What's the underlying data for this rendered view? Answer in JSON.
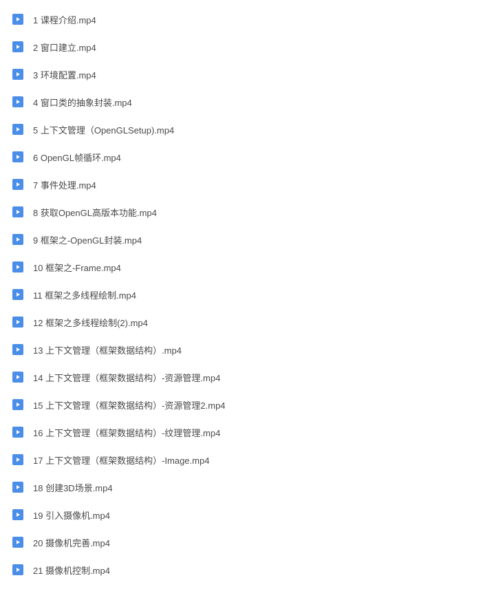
{
  "files": [
    {
      "name": "1 课程介绍.mp4"
    },
    {
      "name": "2 窗口建立.mp4"
    },
    {
      "name": "3 环境配置.mp4"
    },
    {
      "name": "4 窗口类的抽象封装.mp4"
    },
    {
      "name": "5 上下文管理（OpenGLSetup).mp4"
    },
    {
      "name": "6 OpenGL帧循环.mp4"
    },
    {
      "name": "7 事件处理.mp4"
    },
    {
      "name": "8 获取OpenGL高版本功能.mp4"
    },
    {
      "name": "9 框架之-OpenGL封装.mp4"
    },
    {
      "name": "10 框架之-Frame.mp4"
    },
    {
      "name": "11 框架之多线程绘制.mp4"
    },
    {
      "name": "12 框架之多线程绘制(2).mp4"
    },
    {
      "name": "13 上下文管理（框架数据结构）.mp4"
    },
    {
      "name": "14 上下文管理（框架数据结构）-资源管理.mp4"
    },
    {
      "name": "15 上下文管理（框架数据结构）-资源管理2.mp4"
    },
    {
      "name": "16 上下文管理（框架数据结构）-纹理管理.mp4"
    },
    {
      "name": "17 上下文管理（框架数据结构）-Image.mp4"
    },
    {
      "name": "18 创建3D场景.mp4"
    },
    {
      "name": "19 引入摄像机.mp4"
    },
    {
      "name": "20 摄像机完善.mp4"
    },
    {
      "name": "21 摄像机控制.mp4"
    }
  ]
}
